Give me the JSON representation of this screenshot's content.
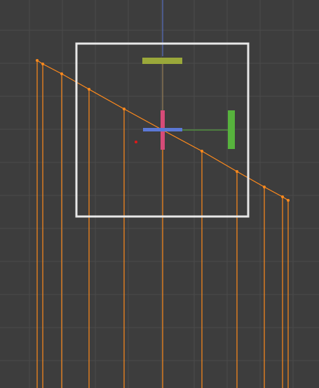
{
  "viewport": {
    "background": "#3d3d3d",
    "grid_color": "#4a4a4a",
    "selection_color": "#ff8a1c",
    "frame_color": "#e8e8e8",
    "axis_colors": {
      "x": "#5b78d6",
      "y": "#57b33d",
      "z": "#d64b78",
      "handle": "#9aa83a"
    }
  },
  "icons": {
    "origin": "origin-marker-icon",
    "transform_gizmo": "transform-gizmo-icon"
  }
}
